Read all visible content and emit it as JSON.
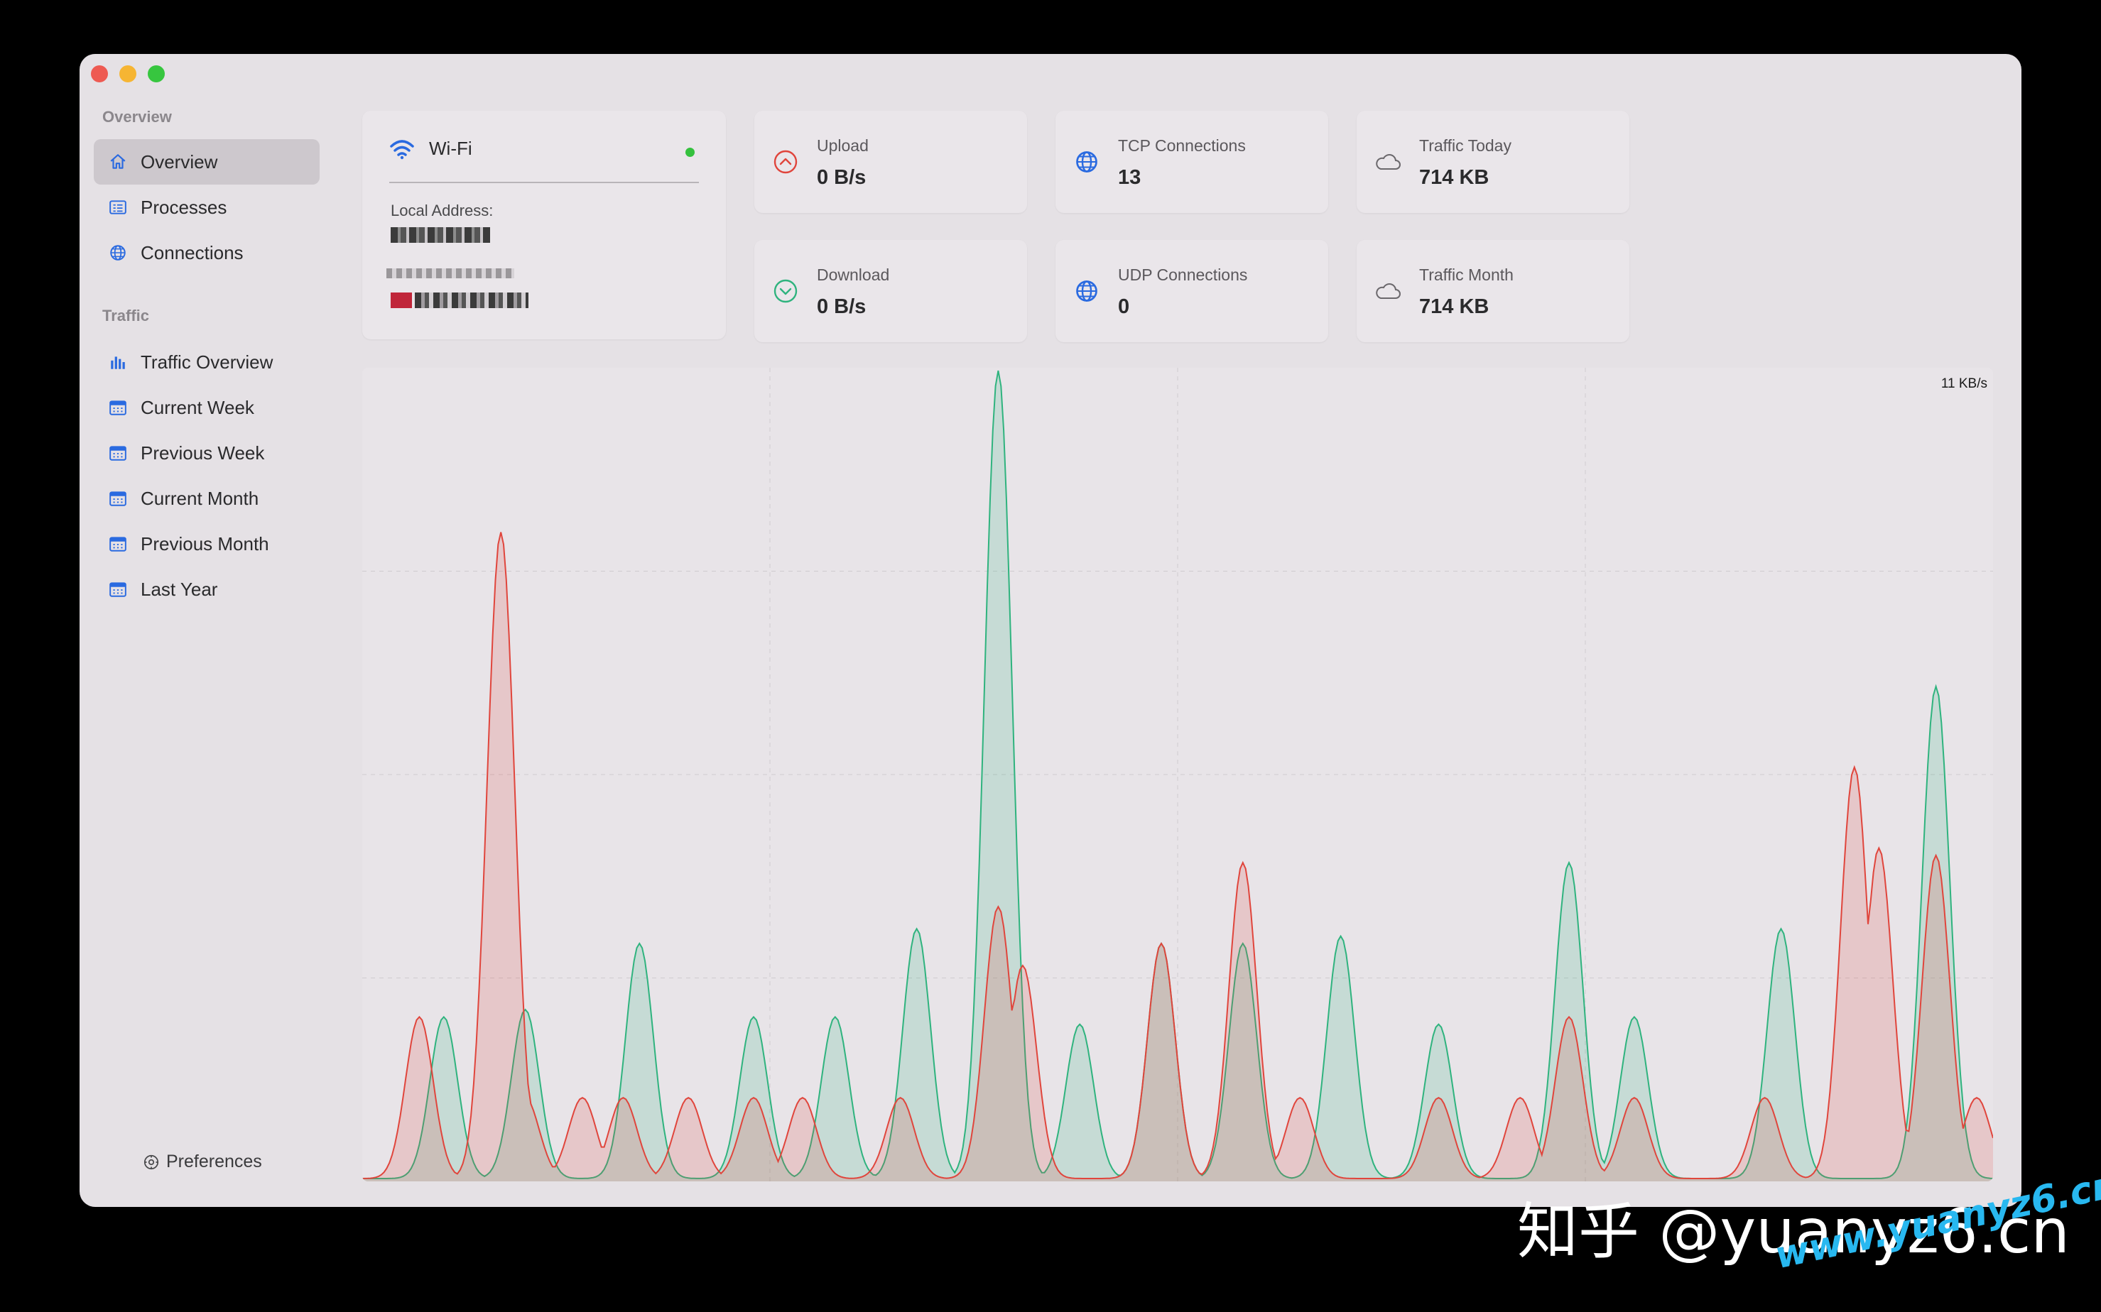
{
  "sidebar": {
    "section_overview": "Overview",
    "section_traffic": "Traffic",
    "overview_items": [
      {
        "label": "Overview",
        "icon": "house-icon"
      },
      {
        "label": "Processes",
        "icon": "list-icon"
      },
      {
        "label": "Connections",
        "icon": "globe-icon"
      }
    ],
    "traffic_items": [
      {
        "label": "Traffic Overview",
        "icon": "bar-chart-icon"
      },
      {
        "label": "Current Week",
        "icon": "calendar-icon"
      },
      {
        "label": "Previous Week",
        "icon": "calendar-icon"
      },
      {
        "label": "Current Month",
        "icon": "calendar-icon"
      },
      {
        "label": "Previous Month",
        "icon": "calendar-icon"
      },
      {
        "label": "Last Year",
        "icon": "calendar-icon"
      }
    ],
    "preferences_label": "Preferences"
  },
  "network": {
    "name": "Wi-Fi",
    "local_address_label": "Local Address:"
  },
  "stats": {
    "upload": {
      "label": "Upload",
      "value": "0 B/s"
    },
    "download": {
      "label": "Download",
      "value": "0 B/s"
    },
    "tcp": {
      "label": "TCP Connections",
      "value": "13"
    },
    "udp": {
      "label": "UDP Connections",
      "value": "0"
    },
    "traffic_today": {
      "label": "Traffic Today",
      "value": "714 KB"
    },
    "traffic_month": {
      "label": "Traffic Month",
      "value": "714 KB"
    }
  },
  "colors": {
    "upload": "#e0453c",
    "download": "#2fb37e",
    "accent": "#2a6ae0",
    "status_online": "#35c13e"
  },
  "chart_data": {
    "type": "area",
    "max_label": "11 KB/s",
    "ylim": [
      0,
      11
    ],
    "series": [
      {
        "color": "#2fb37e",
        "peaks": [
          [
            0.05,
            2.2
          ],
          [
            0.1,
            2.3
          ],
          [
            0.17,
            3.2
          ],
          [
            0.24,
            2.2
          ],
          [
            0.29,
            2.2
          ],
          [
            0.34,
            3.4
          ],
          [
            0.39,
            11
          ],
          [
            0.44,
            2.1
          ],
          [
            0.49,
            3.2
          ],
          [
            0.54,
            3.2
          ],
          [
            0.6,
            3.3
          ],
          [
            0.66,
            2.1
          ],
          [
            0.74,
            4.3
          ],
          [
            0.78,
            2.2
          ],
          [
            0.87,
            3.4
          ],
          [
            0.965,
            6.7
          ]
        ]
      },
      {
        "color": "#e0453c",
        "peaks": [
          [
            0.035,
            2.2
          ],
          [
            0.085,
            8.8
          ],
          [
            0.1,
            1.1
          ],
          [
            0.135,
            1.1
          ],
          [
            0.16,
            1.1
          ],
          [
            0.2,
            1.1
          ],
          [
            0.24,
            1.1
          ],
          [
            0.27,
            1.1
          ],
          [
            0.33,
            1.1
          ],
          [
            0.39,
            3.7
          ],
          [
            0.405,
            2.9
          ],
          [
            0.49,
            3.2
          ],
          [
            0.54,
            4.3
          ],
          [
            0.575,
            1.1
          ],
          [
            0.66,
            1.1
          ],
          [
            0.71,
            1.1
          ],
          [
            0.74,
            2.2
          ],
          [
            0.78,
            1.1
          ],
          [
            0.86,
            1.1
          ],
          [
            0.915,
            5.6
          ],
          [
            0.93,
            4.5
          ],
          [
            0.965,
            4.4
          ],
          [
            0.99,
            1.1
          ]
        ]
      }
    ]
  }
}
